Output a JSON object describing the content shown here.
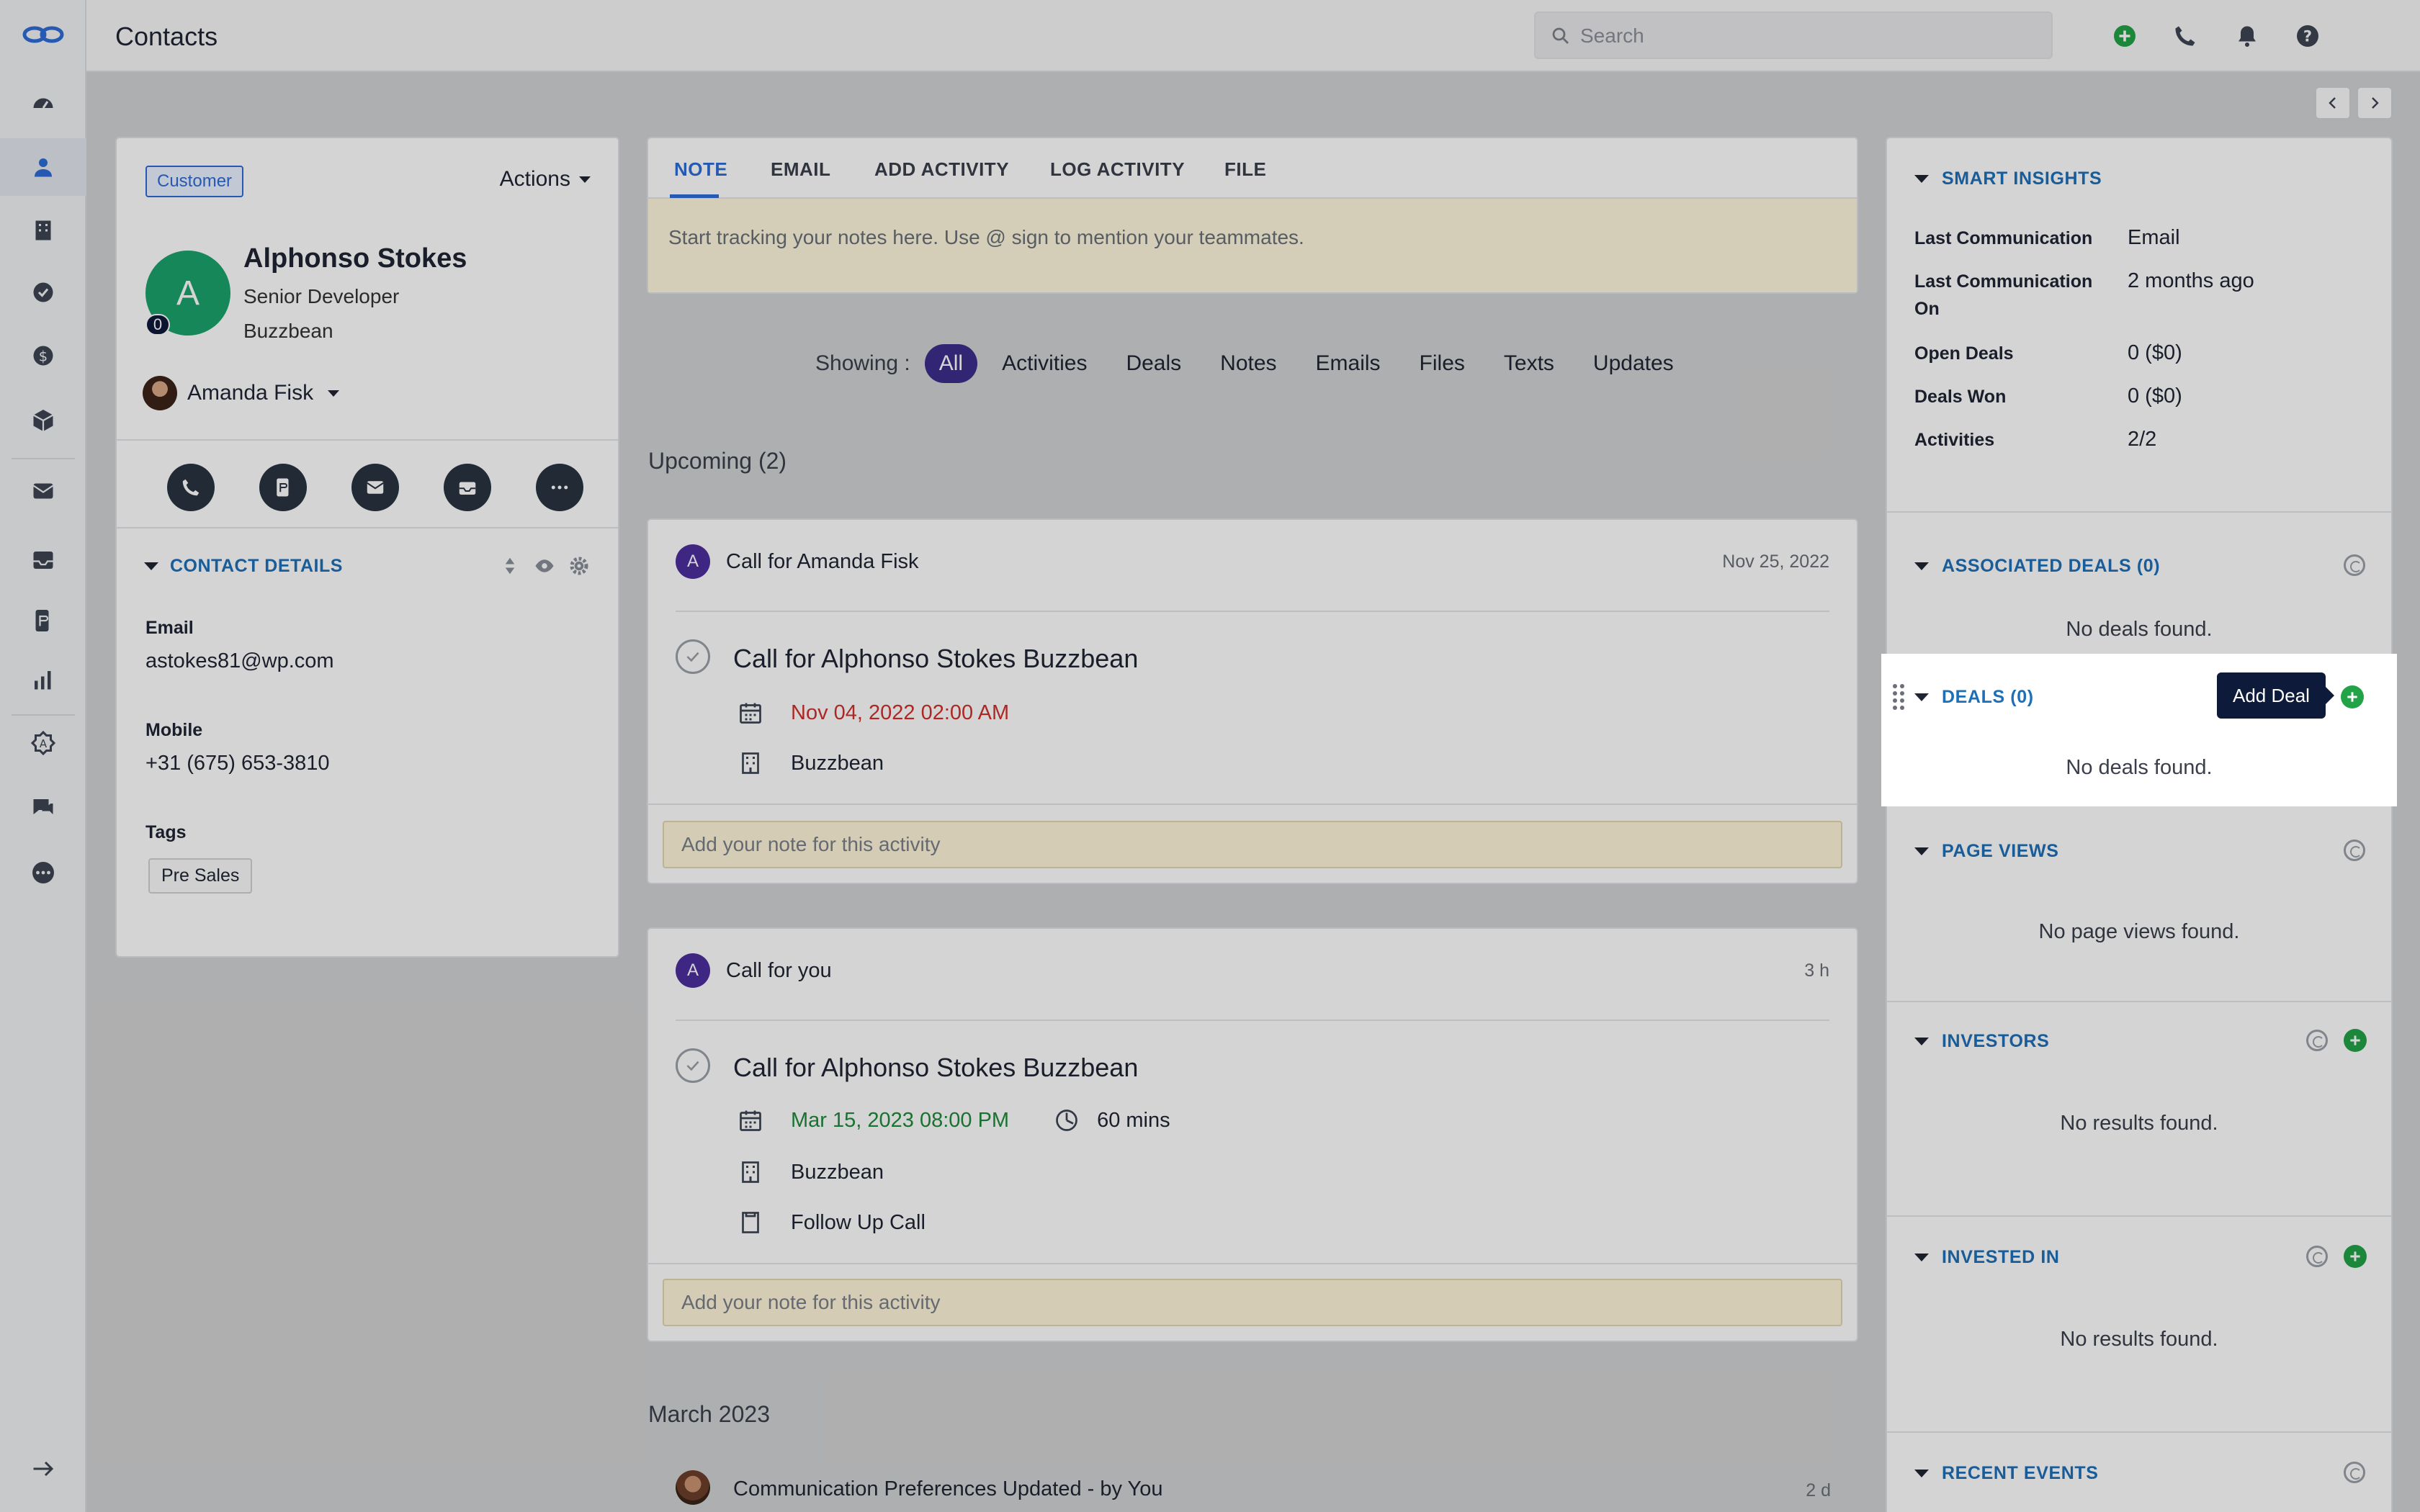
{
  "header": {
    "title": "Contacts",
    "search_placeholder": "Search"
  },
  "contact": {
    "badge": "Customer",
    "actions_label": "Actions",
    "avatar_initial": "A",
    "score": "0",
    "name": "Alphonso Stokes",
    "job_title": "Senior Developer",
    "company": "Buzzbean",
    "owner": "Amanda Fisk",
    "details_heading": "CONTACT DETAILS",
    "email_label": "Email",
    "email_value": "astokes81@wp.com",
    "mobile_label": "Mobile",
    "mobile_value": "+31 (675) 653-3810",
    "tags_label": "Tags",
    "tags": [
      "Pre Sales"
    ]
  },
  "composer": {
    "tabs": [
      "NOTE",
      "EMAIL",
      "ADD ACTIVITY",
      "LOG ACTIVITY",
      "FILE"
    ],
    "active_tab": "NOTE",
    "note_placeholder": "Start tracking your notes here. Use @ sign to mention your teammates."
  },
  "timeline": {
    "showing_label": "Showing :",
    "filters": [
      "All",
      "Activities",
      "Deals",
      "Notes",
      "Emails",
      "Files",
      "Texts",
      "Updates"
    ],
    "active_filter": "All",
    "upcoming_title": "Upcoming (2)",
    "activity1": {
      "avatar": "A",
      "type": "Call",
      "for_text": "for Amanda Fisk",
      "date": "Nov 25, 2022",
      "title": "Call for Alphonso Stokes Buzzbean",
      "due": "Nov 04, 2022 02:00 AM",
      "company": "Buzzbean",
      "note_placeholder": "Add your note for this activity"
    },
    "activity2": {
      "avatar": "A",
      "type": "Call",
      "for_text": "for you",
      "date": "3 h",
      "title": "Call for Alphonso Stokes Buzzbean",
      "due": "Mar 15, 2023 08:00 PM",
      "duration": "60 mins",
      "company": "Buzzbean",
      "outcome": "Follow Up Call",
      "note_placeholder": "Add your note for this activity"
    },
    "month_title": "March 2023",
    "update1": {
      "title": "Communication Preferences Updated",
      "by": "- by You",
      "time": "2 d"
    }
  },
  "right_panel": {
    "smart_insights": {
      "heading": "SMART INSIGHTS",
      "rows": [
        {
          "label": "Last Communication",
          "value": "Email"
        },
        {
          "label": "Last Communication On",
          "value": "2 months ago"
        },
        {
          "label": "Open Deals",
          "value": "0 ($0)"
        },
        {
          "label": "Deals Won",
          "value": "0 ($0)"
        },
        {
          "label": "Activities",
          "value": "2/2"
        }
      ]
    },
    "associated_deals": {
      "heading": "ASSOCIATED DEALS (0)",
      "empty": "No deals found."
    },
    "deals": {
      "heading": "DEALS (0)",
      "empty": "No deals found.",
      "tooltip": "Add Deal"
    },
    "page_views": {
      "heading": "PAGE VIEWS",
      "empty": "No page views found."
    },
    "investors": {
      "heading": "INVESTORS",
      "empty": "No results found."
    },
    "invested_in": {
      "heading": "INVESTED IN",
      "empty": "No results found."
    },
    "recent_events": {
      "heading": "RECENT EVENTS"
    }
  },
  "colors": {
    "accent": "#2e6cd6",
    "section_heading": "#1d6fb8",
    "filter_active": "#3d2e8c",
    "contact_avatar": "#1ba36b",
    "overdue": "#d0312d",
    "upcoming": "#1f8a3a",
    "add_green": "#22a348"
  }
}
